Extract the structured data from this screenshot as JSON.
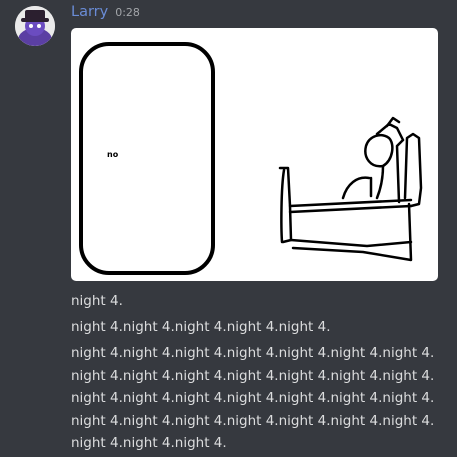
{
  "message": {
    "username": "Larry",
    "timestamp": "0:28",
    "attachment": {
      "door_label": "no"
    },
    "lines": [
      "night 4.",
      "night 4.night 4.night 4.night 4.night 4.",
      "night 4.night 4.night 4.night 4.night 4.night 4.night 4.night 4.night 4.night 4.night 4.night 4.night 4.night 4.night 4.night 4.night 4.night 4.night 4.night 4.night 4.night 4.night 4.night 4.night 4.night 4.night 4.night 4.night 4.night 4.night 4."
    ]
  },
  "colors": {
    "background": "#36393f",
    "username": "#6a8cd6",
    "timestamp": "#a3a6aa",
    "text": "#dcddde",
    "avatar_accent": "#5b3fa3"
  }
}
